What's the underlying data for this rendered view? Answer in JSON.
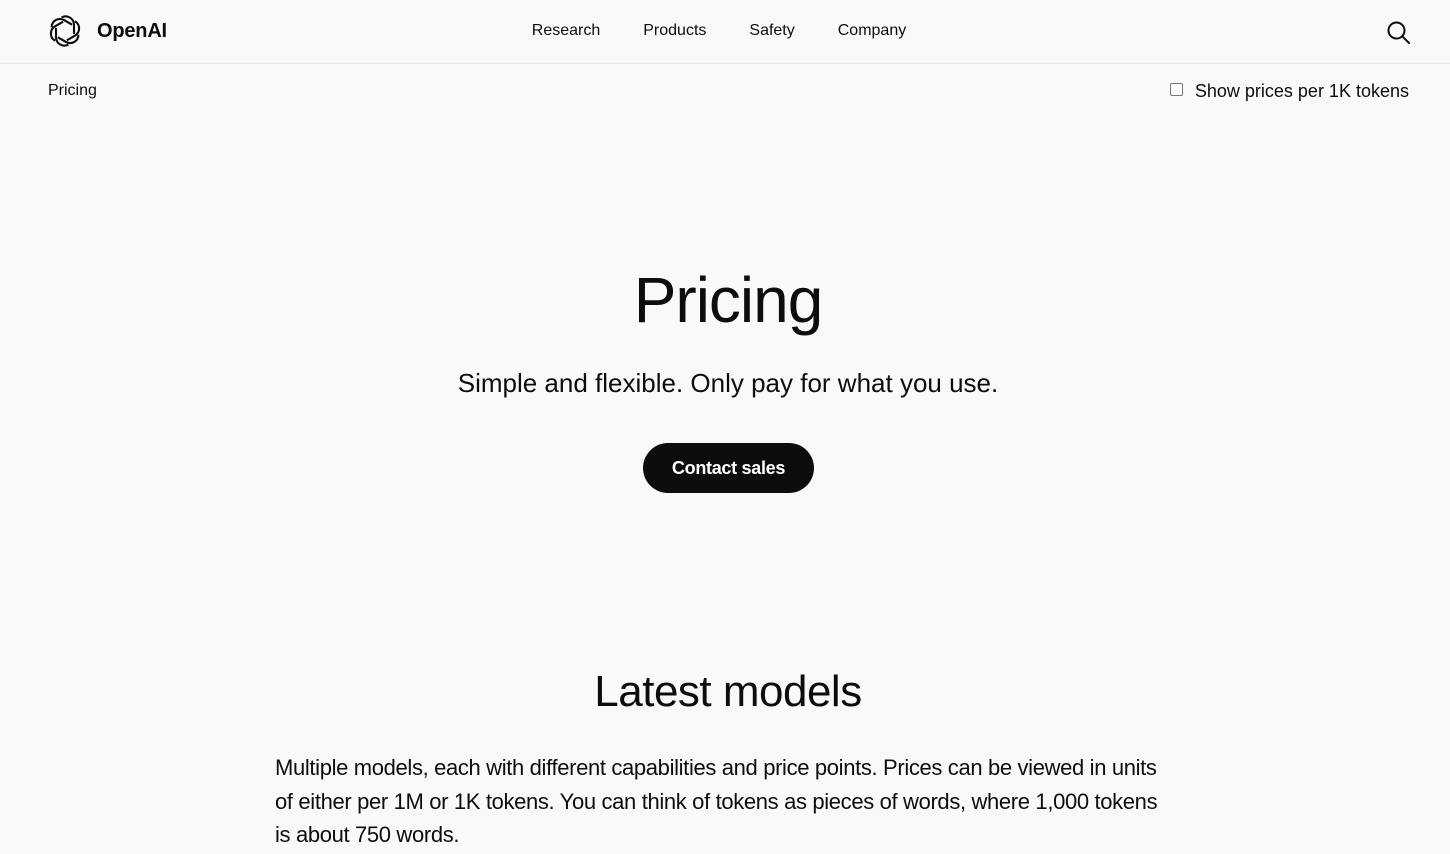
{
  "header": {
    "brand": "OpenAI",
    "nav": [
      {
        "label": "Research"
      },
      {
        "label": "Products"
      },
      {
        "label": "Safety"
      },
      {
        "label": "Company"
      }
    ],
    "search_icon": "search-icon",
    "logo_icon": "openai-logo-icon"
  },
  "subbar": {
    "breadcrumb": "Pricing",
    "toggle_label": "Show prices per 1K tokens",
    "toggle_checked": false
  },
  "hero": {
    "title": "Pricing",
    "subtitle": "Simple and flexible. Only pay for what you use.",
    "cta_label": "Contact sales"
  },
  "latest_models": {
    "title": "Latest models",
    "body": "Multiple models, each with different capabilities and price points. Prices can be viewed in units of either per 1M or 1K tokens. You can think of tokens as pieces of words, where 1,000 tokens is about 750 words."
  },
  "colors": {
    "background": "#f9f9f9",
    "text": "#0d0d0d",
    "button_bg": "#0d0d0d",
    "button_text": "#ffffff",
    "divider": "#e3e3e3"
  }
}
